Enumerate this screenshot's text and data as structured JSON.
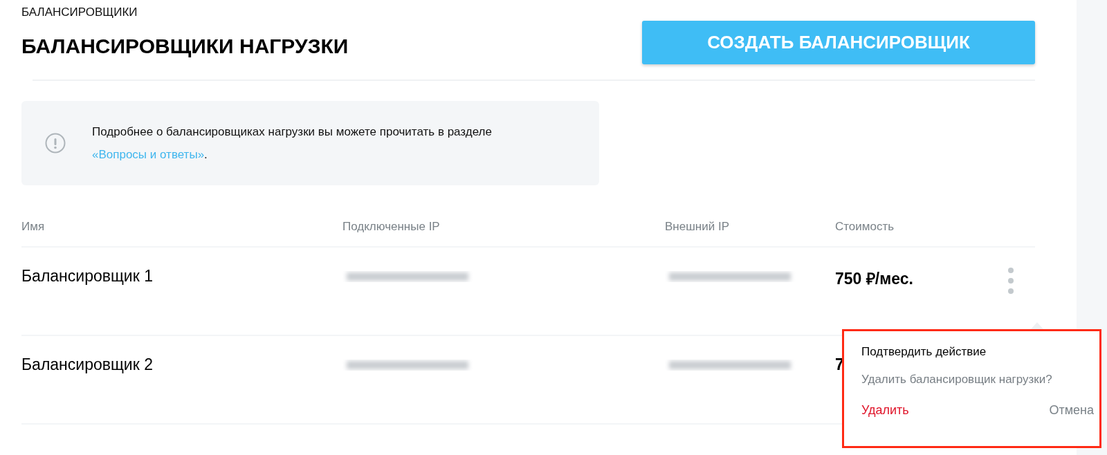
{
  "breadcrumb": "БАЛАНСИРОВЩИКИ",
  "title": "БАЛАНСИРОВЩИКИ НАГРУЗКИ",
  "create_button": "СОЗДАТЬ БАЛАНСИРОВЩИК",
  "info": {
    "text": "Подробнее о балансировщиках нагрузки вы можете прочитать в разделе ",
    "link": "«Вопросы и ответы»",
    "after": "."
  },
  "table": {
    "columns": [
      "Имя",
      "Подключенные IP",
      "Внешний IP",
      "Стоимость"
    ],
    "rows": [
      {
        "name": "Балансировщик 1",
        "price": "750 ₽/мес."
      },
      {
        "name": "Балансировщик 2",
        "price": "7"
      }
    ]
  },
  "popover": {
    "title": "Подтвердить действие",
    "question": "Удалить балансировщик нагрузки?",
    "confirm": "Удалить",
    "cancel": "Отмена"
  }
}
